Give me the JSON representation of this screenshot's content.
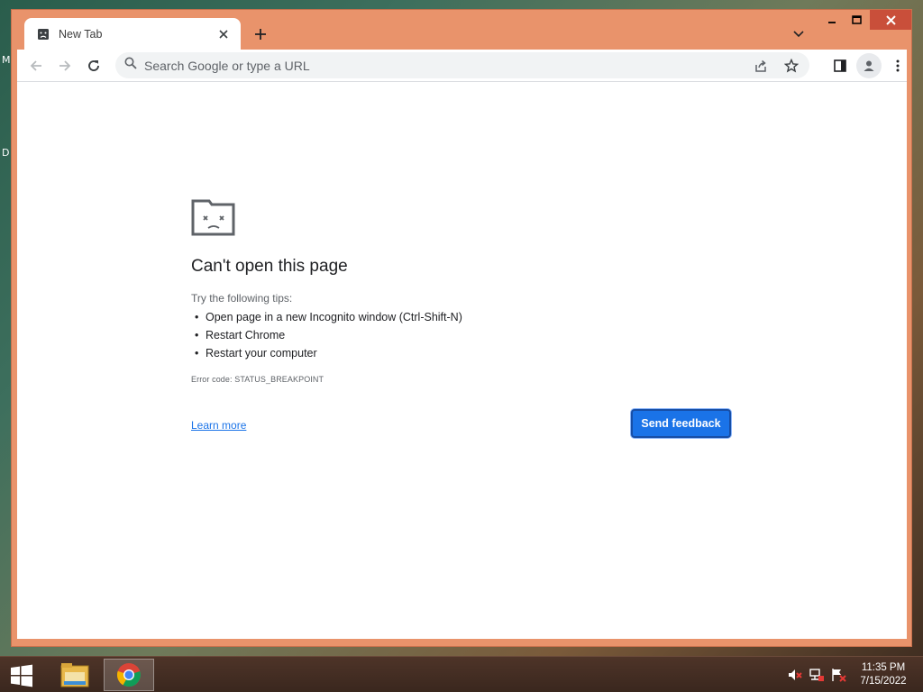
{
  "desktop": {
    "label_1": "M",
    "label_2": "D"
  },
  "browser": {
    "tab": {
      "title": "New Tab",
      "favicon": "sad-page-icon"
    },
    "toolbar": {
      "omnibox_placeholder": "Search Google or type a URL",
      "omnibox_value": ""
    },
    "error_page": {
      "title": "Can't open this page",
      "tips_intro": "Try the following tips:",
      "tips": [
        "Open page in a new Incognito window (Ctrl-Shift-N)",
        "Restart Chrome",
        "Restart your computer"
      ],
      "error_code": "Error code: STATUS_BREAKPOINT",
      "learn_more": "Learn more",
      "send_feedback": "Send feedback"
    }
  },
  "taskbar": {
    "clock_time": "11:35 PM",
    "clock_date": "7/15/2022",
    "items": [
      "file-explorer-icon",
      "chrome-icon"
    ]
  },
  "colors": {
    "window_frame": "#e9936b",
    "accent_button": "#1a73e8",
    "link": "#1a73e8",
    "close_button": "#c94f3a"
  }
}
